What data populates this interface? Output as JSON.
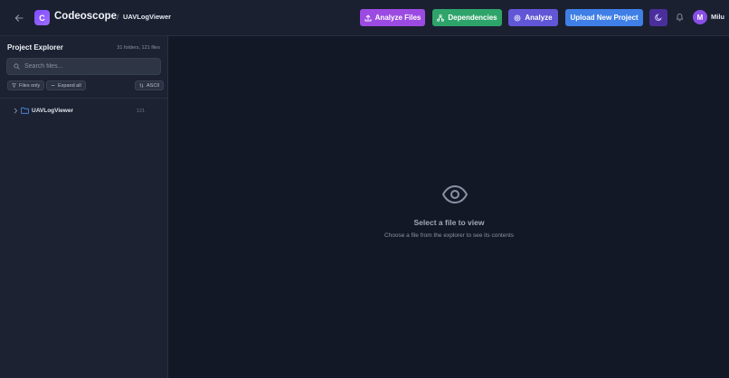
{
  "header": {
    "brand": "Codeoscope",
    "logo_letter": "C",
    "breadcrumb_sep": "/",
    "project_name": "UAVLogViewer",
    "buttons": {
      "analyze_files": "Analyze Files",
      "dependencies": "Dependencies",
      "analyze": "Analyze",
      "upload": "Upload New Project"
    },
    "user": {
      "initial": "M",
      "name": "Milu"
    }
  },
  "sidebar": {
    "title": "Project Explorer",
    "count": "31 folders, 121 files",
    "search_placeholder": "Search files...",
    "chips": {
      "files_only": "Files only",
      "expand_all": "Expand all",
      "ascii": "ASCII"
    },
    "tree": [
      {
        "label": "UAVLogViewer",
        "count": "121",
        "icon": "folder-icon"
      }
    ]
  },
  "main": {
    "empty_title": "Select a file to view",
    "empty_subtitle": "Choose a file from the explorer to see its contents"
  },
  "colors": {
    "background": "#141a29",
    "analyze_files": "#9c4be2",
    "dependencies": "#2fa46a",
    "analyze": "#6156d6",
    "upload": "#3f7fe6",
    "accent": "#7c4dff"
  }
}
